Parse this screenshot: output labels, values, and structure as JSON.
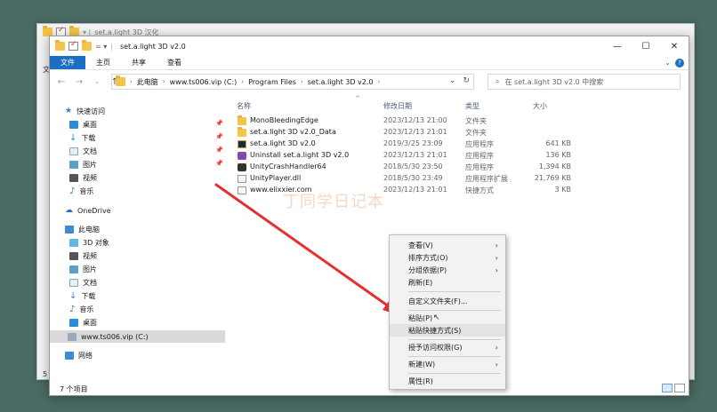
{
  "bg_window": {
    "title": "set.a.light 3D 汉化",
    "side_letters": [
      "文",
      "5",
      "5"
    ]
  },
  "window": {
    "title": "set.a.light 3D v2.0",
    "controls": {
      "minimize": "—",
      "maximize": "☐",
      "close": "✕"
    }
  },
  "ribbon": {
    "tabs": [
      "文件",
      "主页",
      "共享",
      "查看"
    ]
  },
  "address": {
    "crumbs": [
      "此电脑",
      "www.ts006.vip (C:)",
      "Program Files",
      "set.a.light 3D v2.0"
    ],
    "search_placeholder": "在 set.a.light 3D v2.0 中搜索"
  },
  "sidebar": {
    "items": [
      {
        "label": "快速访问",
        "icon": "star-icon",
        "pinned": false
      },
      {
        "label": "桌面",
        "icon": "desktop-icon",
        "pinned": true
      },
      {
        "label": "下载",
        "icon": "download-icon",
        "pinned": true
      },
      {
        "label": "文档",
        "icon": "document-icon",
        "pinned": true
      },
      {
        "label": "图片",
        "icon": "pictures-icon",
        "pinned": true
      },
      {
        "label": "视频",
        "icon": "video-icon",
        "pinned": false
      },
      {
        "label": "音乐",
        "icon": "music-icon",
        "pinned": false
      },
      {
        "label": "OneDrive",
        "icon": "cloud-icon",
        "pinned": false
      },
      {
        "label": "此电脑",
        "icon": "computer-icon",
        "pinned": false
      },
      {
        "label": "3D 对象",
        "icon": "cube-icon",
        "pinned": false
      },
      {
        "label": "视频",
        "icon": "video-icon",
        "pinned": false
      },
      {
        "label": "图片",
        "icon": "pictures-icon",
        "pinned": false
      },
      {
        "label": "文档",
        "icon": "document-icon",
        "pinned": false
      },
      {
        "label": "下载",
        "icon": "download-icon",
        "pinned": false
      },
      {
        "label": "音乐",
        "icon": "music-icon",
        "pinned": false
      },
      {
        "label": "桌面",
        "icon": "desktop-icon",
        "pinned": false
      },
      {
        "label": "www.ts006.vip (C:)",
        "icon": "drive-icon",
        "pinned": false,
        "selected": true
      },
      {
        "label": "网络",
        "icon": "network-icon",
        "pinned": false
      }
    ]
  },
  "columns": {
    "name": "名称",
    "date": "修改日期",
    "type": "类型",
    "size": "大小"
  },
  "files": [
    {
      "name": "MonoBleedingEdge",
      "date": "2023/12/13 21:00",
      "type": "文件夹",
      "size": "",
      "icon": "folder-icon"
    },
    {
      "name": "set.a.light 3D v2.0_Data",
      "date": "2023/12/13 21:01",
      "type": "文件夹",
      "size": "",
      "icon": "folder-icon"
    },
    {
      "name": "set.a.light 3D v2.0",
      "date": "2019/3/25 23:09",
      "type": "应用程序",
      "size": "641 KB",
      "icon": "app-icon"
    },
    {
      "name": "Uninstall set.a.light 3D v2.0",
      "date": "2023/12/13 21:01",
      "type": "应用程序",
      "size": "136 KB",
      "icon": "uninstall-icon"
    },
    {
      "name": "UnityCrashHandler64",
      "date": "2018/5/30 23:50",
      "type": "应用程序",
      "size": "1,394 KB",
      "icon": "unity-icon"
    },
    {
      "name": "UnityPlayer.dll",
      "date": "2018/5/30 23:49",
      "type": "应用程序扩展",
      "size": "21,769 KB",
      "icon": "dll-icon"
    },
    {
      "name": "www.elixxier.com",
      "date": "2023/12/13 21:01",
      "type": "快捷方式",
      "size": "3 KB",
      "icon": "shortcut-icon"
    }
  ],
  "status": {
    "count": "7 个项目"
  },
  "watermark": "丁同学日记本",
  "context_menu": {
    "items": [
      {
        "label": "查看(V)",
        "submenu": true
      },
      {
        "label": "排序方式(O)",
        "submenu": true
      },
      {
        "label": "分组依据(P)",
        "submenu": true
      },
      {
        "label": "刷新(E)",
        "submenu": false
      },
      {
        "label": "自定义文件夹(F)...",
        "submenu": false
      },
      {
        "label": "粘贴(P)",
        "submenu": false
      },
      {
        "label": "粘贴快捷方式(S)",
        "submenu": false,
        "highlighted": true
      },
      {
        "label": "授予访问权限(G)",
        "submenu": true
      },
      {
        "label": "新建(W)",
        "submenu": true
      },
      {
        "label": "属性(R)",
        "submenu": false
      }
    ]
  },
  "colors": {
    "accent": "#1a6fc4",
    "folder": "#f4c54a",
    "arrow": "#e53030",
    "desktop_bg": "#4a6b63"
  }
}
